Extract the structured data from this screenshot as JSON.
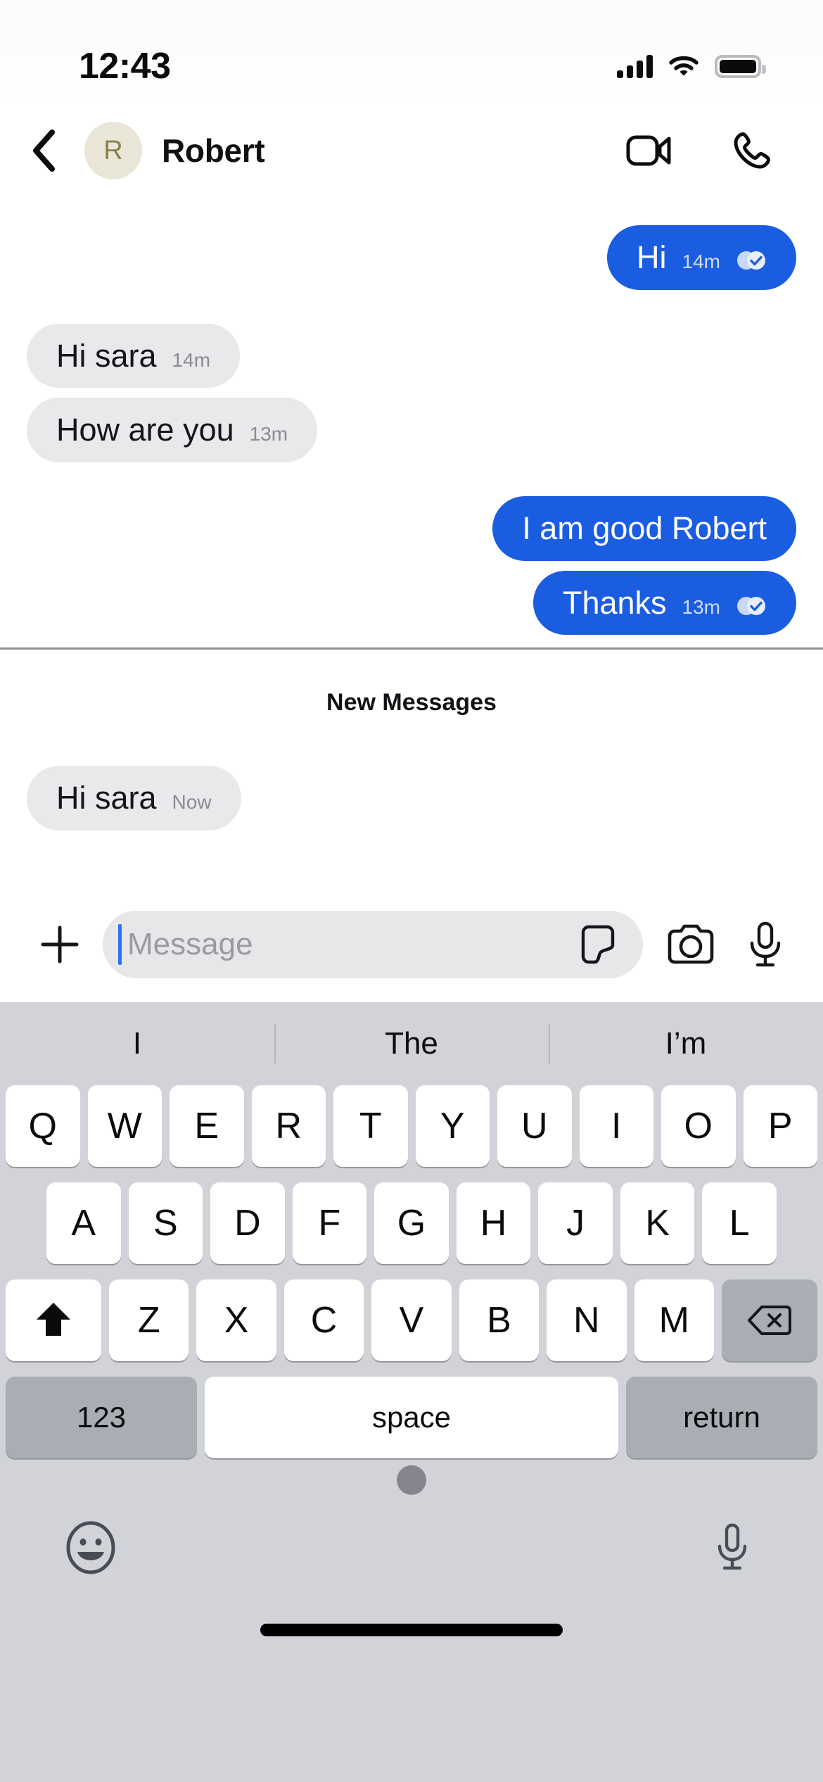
{
  "status_bar": {
    "time": "12:43",
    "signal_icon": "cellular-signal-icon",
    "wifi_icon": "wifi-icon",
    "battery_icon": "battery-full-icon"
  },
  "header": {
    "back_icon": "chevron-left-icon",
    "avatar_initial": "R",
    "avatar_bg": "#e9e6d8",
    "avatar_color": "#8a8148",
    "contact_name": "Robert",
    "video_call_icon": "video-camera-icon",
    "voice_call_icon": "phone-icon"
  },
  "theme": {
    "outgoing_bubble": "#1b5de0",
    "outgoing_text": "#ffffff",
    "incoming_bubble": "#e9e9eb",
    "incoming_text": "#16161a",
    "accent": "#2f6ff0",
    "keyboard_bg": "#d1d3d9",
    "key_bg": "#ffffff",
    "key_fn_bg": "#abadb5"
  },
  "conversation": {
    "messages": [
      {
        "id": "m1",
        "text": "Hi",
        "time": "14m",
        "direction": "out",
        "receipt": "read"
      },
      {
        "id": "m2",
        "text": "Hi sara",
        "time": "14m",
        "direction": "in",
        "receipt": "none"
      },
      {
        "id": "m3",
        "text": "How are you",
        "time": "13m",
        "direction": "in",
        "receipt": "none"
      },
      {
        "id": "m4",
        "text": "I am good Robert",
        "time": "",
        "direction": "out",
        "receipt": "none"
      },
      {
        "id": "m5",
        "text": "Thanks",
        "time": "13m",
        "direction": "out",
        "receipt": "read"
      }
    ],
    "new_messages_label": "New Messages",
    "new_messages": [
      {
        "id": "n1",
        "text": "Hi sara",
        "time": "Now",
        "direction": "in",
        "receipt": "none"
      }
    ]
  },
  "input_bar": {
    "add_icon": "plus-icon",
    "message_value": "",
    "message_placeholder": "Message",
    "sticker_icon": "sticker-icon",
    "camera_icon": "camera-icon",
    "mic_icon": "microphone-icon"
  },
  "keyboard": {
    "suggestions": [
      "I",
      "The",
      "I’m"
    ],
    "row1": [
      "Q",
      "W",
      "E",
      "R",
      "T",
      "Y",
      "U",
      "I",
      "O",
      "P"
    ],
    "row2": [
      "A",
      "S",
      "D",
      "F",
      "G",
      "H",
      "J",
      "K",
      "L"
    ],
    "row3": [
      "Z",
      "X",
      "C",
      "V",
      "B",
      "N",
      "M"
    ],
    "shift_icon": "shift-arrow-up-icon",
    "delete_icon": "backspace-delete-icon",
    "numbers_key": "123",
    "space_key": "space",
    "return_key": "return",
    "emoji_icon": "emoji-smiley-icon",
    "dictation_icon": "microphone-icon",
    "drag_handle_icon": "keyboard-drag-handle-icon",
    "home_indicator_icon": "home-indicator"
  }
}
